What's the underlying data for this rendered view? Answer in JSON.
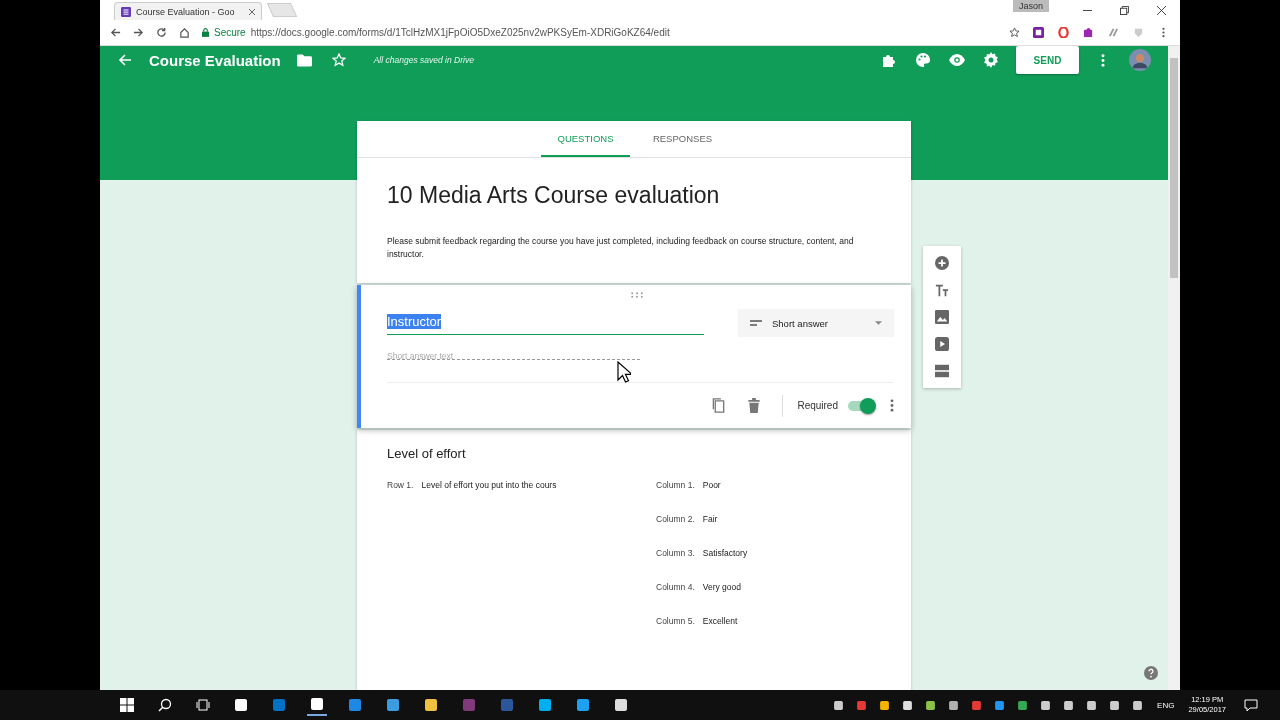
{
  "browser": {
    "tab_title": "Course Evaluation - Goo",
    "profile": "Jason",
    "secure_label": "Secure",
    "url": "https://docs.google.com/forms/d/1TclHzMX1jFpOiO5DxeZ025nv2wPKSyEm-XDRiGoKZ64/edit"
  },
  "header": {
    "title": "Course Evaluation",
    "save_status": "All changes saved in Drive",
    "send_label": "SEND"
  },
  "tabs": [
    {
      "label": "QUESTIONS",
      "selected": true
    },
    {
      "label": "RESPONSES",
      "selected": false
    }
  ],
  "form": {
    "title": "10 Media Arts Course evaluation",
    "description": "Please submit feedback regarding the course you have just completed, including feedback on course structure, content, and instructor."
  },
  "active_question": {
    "title": "Instructor",
    "type": "Short answer",
    "answer_placeholder": "Short answer text",
    "required_label": "Required",
    "required": true
  },
  "grid_question": {
    "title": "Level of effort",
    "rows": [
      {
        "prefix": "Row 1.",
        "label": "Level of effort you put into the cours"
      }
    ],
    "columns": [
      {
        "prefix": "Column 1.",
        "label": "Poor"
      },
      {
        "prefix": "Column 2.",
        "label": "Fair"
      },
      {
        "prefix": "Column 3.",
        "label": "Satisfactory"
      },
      {
        "prefix": "Column 4.",
        "label": "Very good"
      },
      {
        "prefix": "Column 5.",
        "label": "Excellent"
      }
    ]
  },
  "taskbar": {
    "language": "ENG",
    "time": "12:19 PM",
    "date": "29/05/2017"
  }
}
